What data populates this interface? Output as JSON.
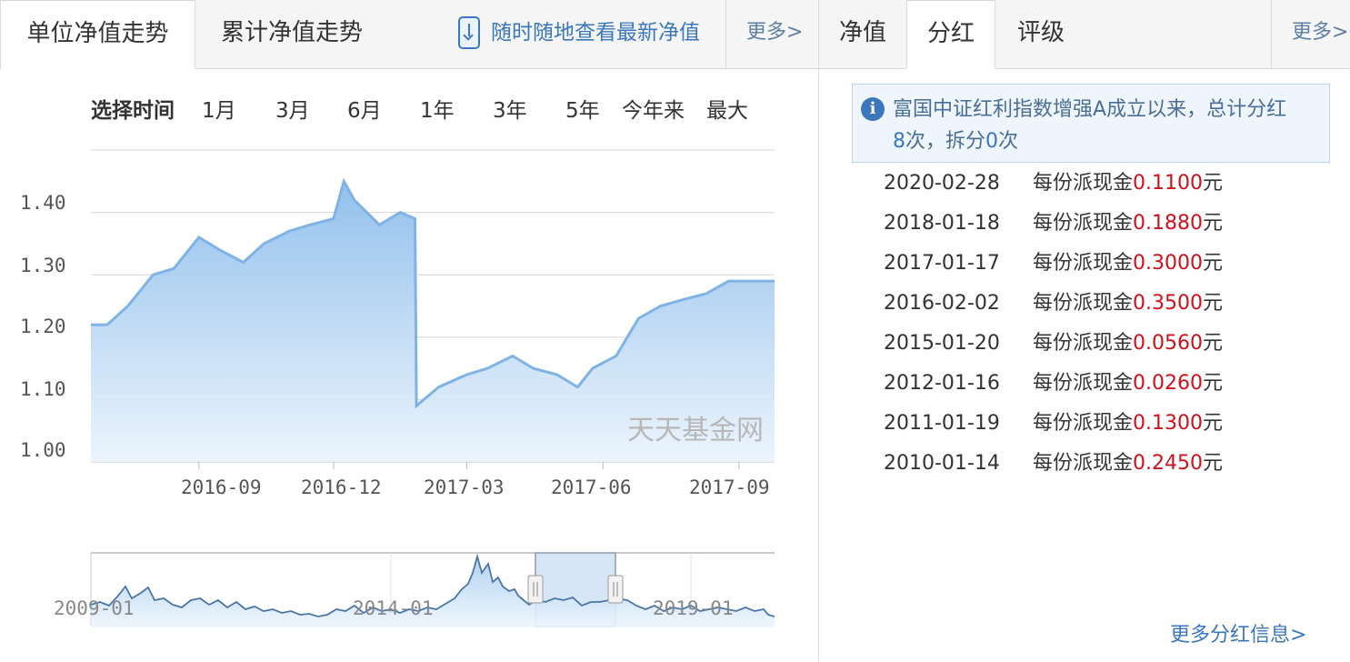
{
  "left_tabs": [
    {
      "label": "单位净值走势",
      "active": true
    },
    {
      "label": "累计净值走势",
      "active": false
    }
  ],
  "promo": {
    "label": "随时随地查看最新净值"
  },
  "left_more": "更多>",
  "right_tabs": [
    {
      "label": "净值",
      "active": false
    },
    {
      "label": "分红",
      "active": true
    },
    {
      "label": "评级",
      "active": false
    }
  ],
  "right_more": "更多>",
  "time_range": {
    "label": "选择时间",
    "options": [
      "1月",
      "3月",
      "6月",
      "1年",
      "3年",
      "5年",
      "今年来",
      "最大"
    ]
  },
  "chart_data": {
    "type": "area",
    "title": "",
    "ylabel": "",
    "xlabel": "",
    "ylim": [
      1.0,
      1.43
    ],
    "yticks": [
      "1.00",
      "1.10",
      "1.20",
      "1.30",
      "1.40"
    ],
    "xticks": [
      "2016-09",
      "2016-12",
      "2017-03",
      "2017-06",
      "2017-09"
    ],
    "x": [
      "2016-06-20",
      "2016-07-01",
      "2016-07-15",
      "2016-08-01",
      "2016-08-15",
      "2016-09-01",
      "2016-09-15",
      "2016-10-01",
      "2016-10-15",
      "2016-11-01",
      "2016-11-15",
      "2016-12-01",
      "2016-12-08",
      "2016-12-15",
      "2017-01-01",
      "2017-01-15",
      "2017-01-25",
      "2017-01-26",
      "2017-02-10",
      "2017-03-01",
      "2017-03-15",
      "2017-04-01",
      "2017-04-15",
      "2017-05-01",
      "2017-05-15",
      "2017-05-25",
      "2017-06-10",
      "2017-06-25",
      "2017-07-10",
      "2017-07-25",
      "2017-08-10",
      "2017-08-25",
      "2017-09-10",
      "2017-09-25"
    ],
    "y": [
      1.22,
      1.22,
      1.25,
      1.3,
      1.31,
      1.36,
      1.34,
      1.32,
      1.35,
      1.37,
      1.38,
      1.39,
      1.45,
      1.42,
      1.38,
      1.4,
      1.39,
      1.09,
      1.12,
      1.14,
      1.15,
      1.17,
      1.15,
      1.14,
      1.12,
      1.15,
      1.17,
      1.23,
      1.25,
      1.26,
      1.27,
      1.29,
      1.29,
      1.29
    ],
    "grid": true,
    "watermark": "天天基金网"
  },
  "overview": {
    "xticks": [
      "2009-01",
      "2014-01",
      "2019-01"
    ],
    "selection": "2016-06 ~ 2017-09"
  },
  "info": {
    "fund_name": "富国中证红利指数增强A",
    "text1": "成立以来，总计分红",
    "dividend_count": "8",
    "text2": "次，拆分",
    "split_count": "0",
    "text3": "次"
  },
  "dividends": [
    {
      "date": "2020-02-28",
      "prefix": "每份派现金",
      "amount": "0.1100",
      "unit": "元"
    },
    {
      "date": "2018-01-18",
      "prefix": "每份派现金",
      "amount": "0.1880",
      "unit": "元"
    },
    {
      "date": "2017-01-17",
      "prefix": "每份派现金",
      "amount": "0.3000",
      "unit": "元"
    },
    {
      "date": "2016-02-02",
      "prefix": "每份派现金",
      "amount": "0.3500",
      "unit": "元"
    },
    {
      "date": "2015-01-20",
      "prefix": "每份派现金",
      "amount": "0.0560",
      "unit": "元"
    },
    {
      "date": "2012-01-16",
      "prefix": "每份派现金",
      "amount": "0.0260",
      "unit": "元"
    },
    {
      "date": "2011-01-19",
      "prefix": "每份派现金",
      "amount": "0.1300",
      "unit": "元"
    },
    {
      "date": "2010-01-14",
      "prefix": "每份派现金",
      "amount": "0.2450",
      "unit": "元"
    }
  ],
  "more_dividend": "更多分红信息>",
  "colors": {
    "accent": "#3b77bd",
    "amount": "#d0111b",
    "line": "#7fb2e5",
    "area": "#a9cdf0"
  }
}
